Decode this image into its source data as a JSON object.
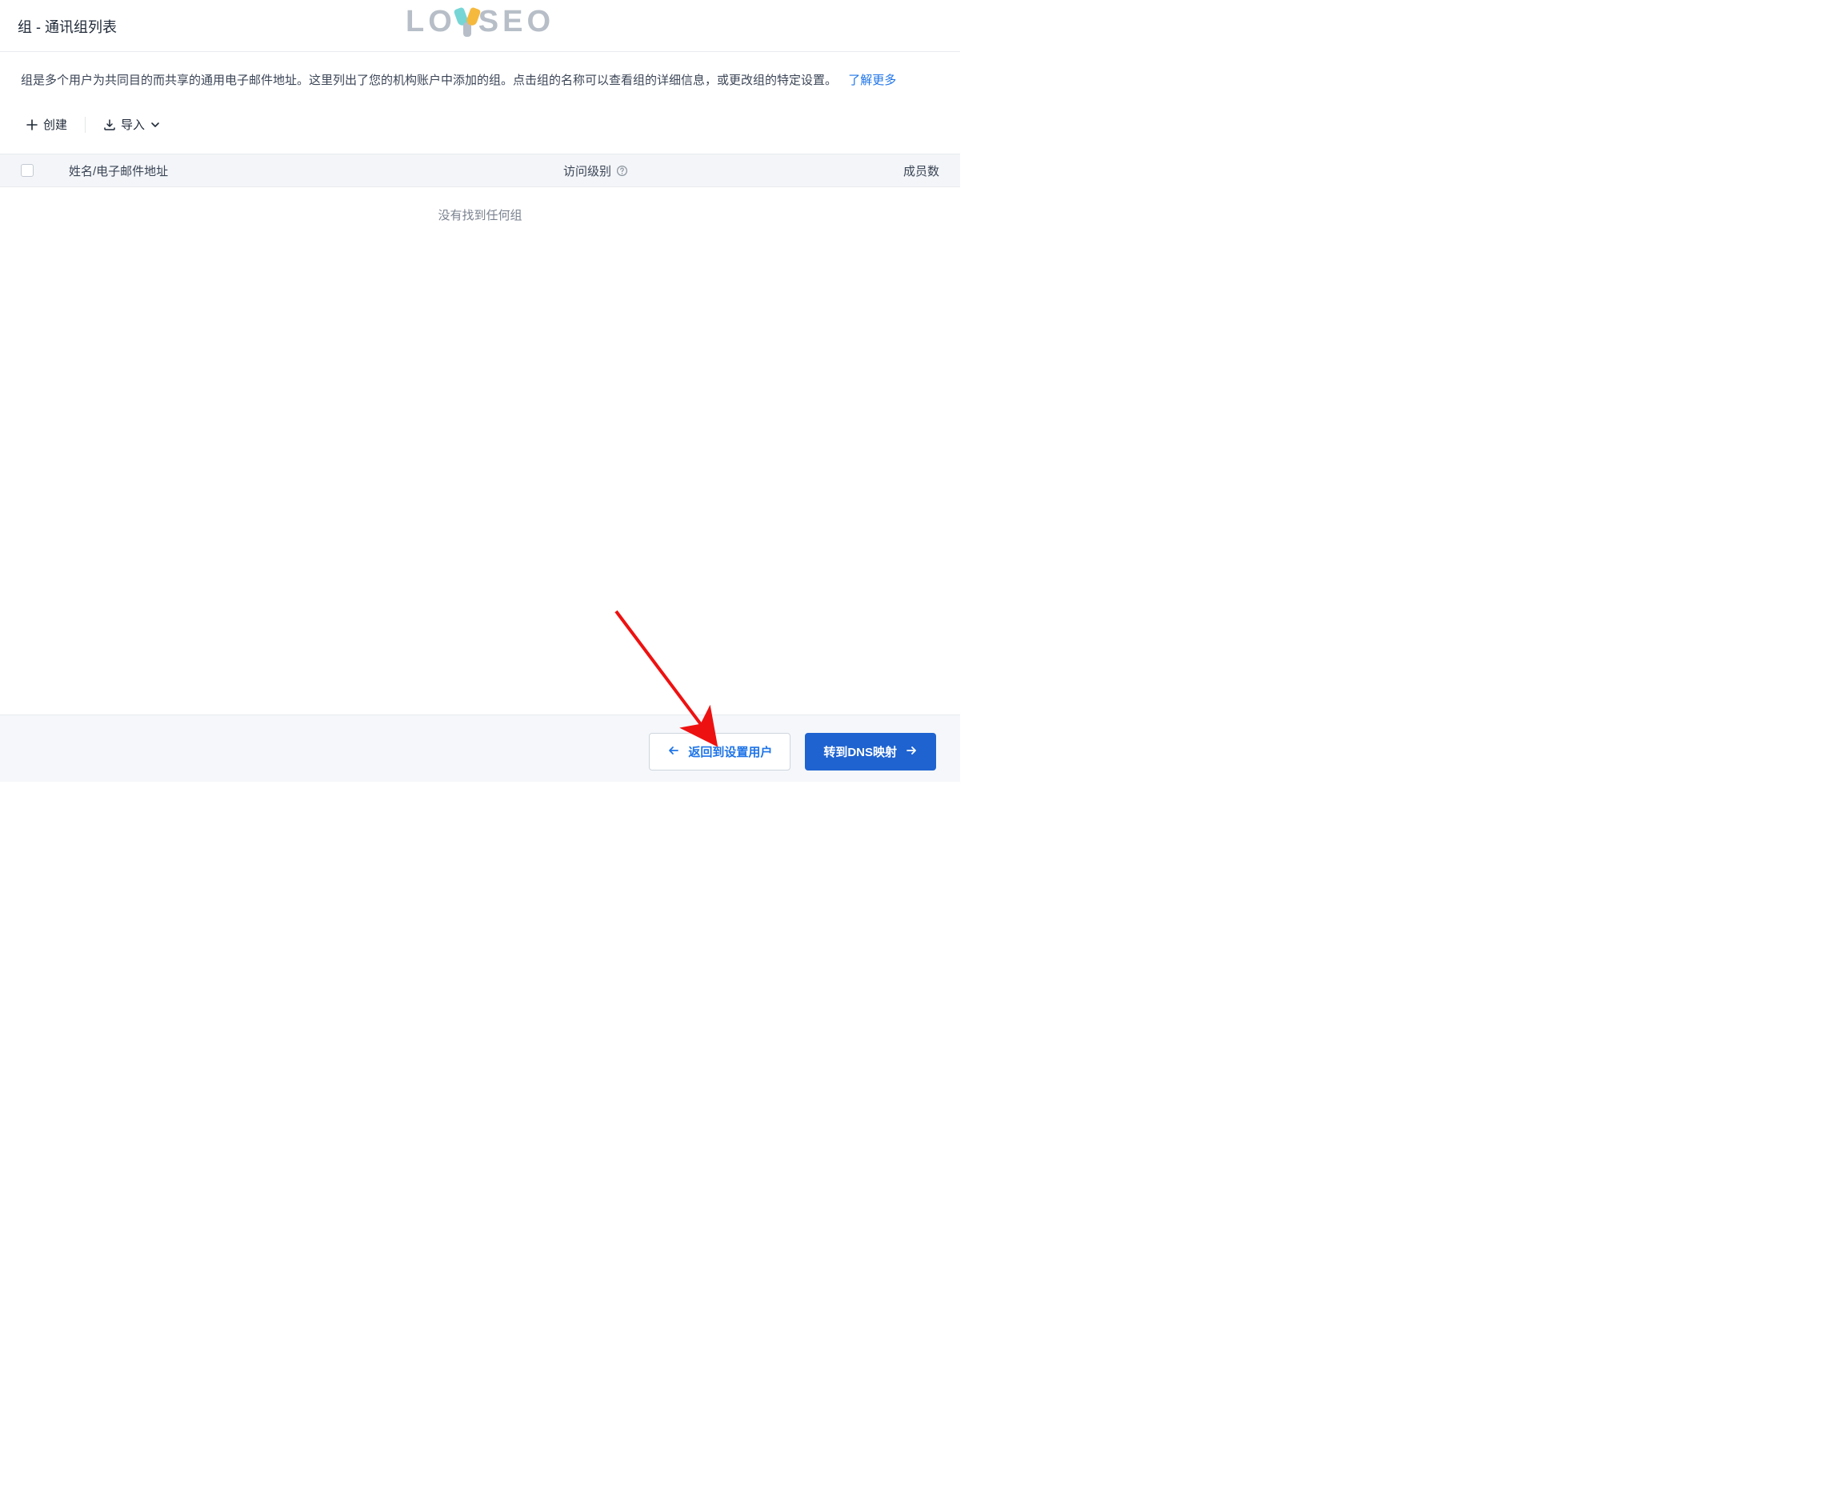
{
  "header": {
    "title": "组 - 通讯组列表"
  },
  "watermark": {
    "part1": "LO",
    "part2": "SEO"
  },
  "description": {
    "text": "组是多个用户为共同目的而共享的通用电子邮件地址。这里列出了您的机构账户中添加的组。点击组的名称可以查看组的详细信息，或更改组的特定设置。",
    "learn_more": "了解更多"
  },
  "toolbar": {
    "create_label": "创建",
    "import_label": "导入"
  },
  "table": {
    "columns": {
      "name": "姓名/电子邮件地址",
      "access": "访问级别",
      "members": "成员数"
    },
    "empty_message": "没有找到任何组"
  },
  "footer": {
    "back_label": "返回到设置用户",
    "next_label": "转到DNS映射"
  }
}
